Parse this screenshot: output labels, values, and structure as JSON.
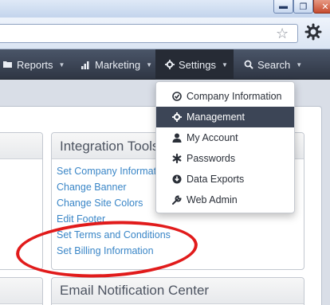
{
  "nav": {
    "items": [
      {
        "label": "Reports",
        "icon": "folder-icon"
      },
      {
        "label": "Marketing",
        "icon": "bar-chart-icon"
      },
      {
        "label": "Settings",
        "icon": "gear-icon"
      },
      {
        "label": "Search",
        "icon": "search-icon"
      }
    ]
  },
  "dropdown": {
    "items": [
      {
        "label": "Company Information",
        "icon": "check-circle-icon"
      },
      {
        "label": "Management",
        "icon": "gear-icon"
      },
      {
        "label": "My Account",
        "icon": "user-icon"
      },
      {
        "label": "Passwords",
        "icon": "asterisk-icon"
      },
      {
        "label": "Data Exports",
        "icon": "download-icon"
      },
      {
        "label": "Web Admin",
        "icon": "wrench-icon"
      }
    ]
  },
  "integration_tools": {
    "title": "Integration Tools",
    "links": [
      "Set Company Information",
      "Change Banner",
      "Change Site Colors",
      "Edit Footer",
      "Set Terms and Conditions",
      "Set Billing Information"
    ]
  },
  "email_center": {
    "title": "Email Notification Center"
  },
  "colors": {
    "navbar": "#3a4252",
    "link": "#3a86c7",
    "highlight_oval": "#e11b1b",
    "dropdown_active": "#3c4556"
  }
}
